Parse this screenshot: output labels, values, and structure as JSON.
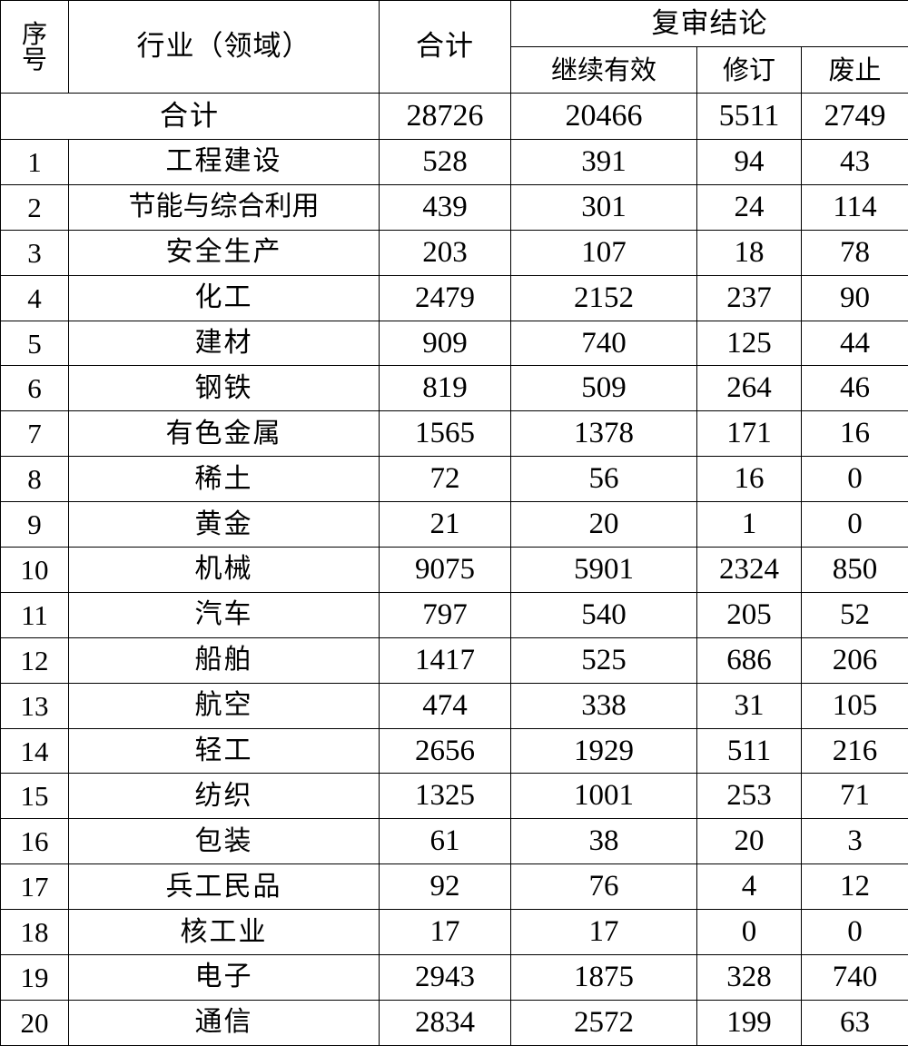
{
  "table": {
    "headers": {
      "index": "序\n号",
      "index_line1": "序",
      "index_line2": "号",
      "name": "行业（领域）",
      "total": "合计",
      "review_group": "复审结论",
      "still_valid": "继续有效",
      "revised": "修订",
      "abolished": "废止"
    },
    "totals_row": {
      "label": "合计",
      "total": "28726",
      "still_valid": "20466",
      "revised": "5511",
      "abolished": "2749"
    },
    "rows": [
      {
        "index": "1",
        "name": "工程建设",
        "total": "528",
        "still_valid": "391",
        "revised": "94",
        "abolished": "43"
      },
      {
        "index": "2",
        "name": "节能与综合利用",
        "total": "439",
        "still_valid": "301",
        "revised": "24",
        "abolished": "114"
      },
      {
        "index": "3",
        "name": "安全生产",
        "total": "203",
        "still_valid": "107",
        "revised": "18",
        "abolished": "78"
      },
      {
        "index": "4",
        "name": "化工",
        "total": "2479",
        "still_valid": "2152",
        "revised": "237",
        "abolished": "90"
      },
      {
        "index": "5",
        "name": "建材",
        "total": "909",
        "still_valid": "740",
        "revised": "125",
        "abolished": "44"
      },
      {
        "index": "6",
        "name": "钢铁",
        "total": "819",
        "still_valid": "509",
        "revised": "264",
        "abolished": "46"
      },
      {
        "index": "7",
        "name": "有色金属",
        "total": "1565",
        "still_valid": "1378",
        "revised": "171",
        "abolished": "16"
      },
      {
        "index": "8",
        "name": "稀土",
        "total": "72",
        "still_valid": "56",
        "revised": "16",
        "abolished": "0"
      },
      {
        "index": "9",
        "name": "黄金",
        "total": "21",
        "still_valid": "20",
        "revised": "1",
        "abolished": "0"
      },
      {
        "index": "10",
        "name": "机械",
        "total": "9075",
        "still_valid": "5901",
        "revised": "2324",
        "abolished": "850"
      },
      {
        "index": "11",
        "name": "汽车",
        "total": "797",
        "still_valid": "540",
        "revised": "205",
        "abolished": "52"
      },
      {
        "index": "12",
        "name": "船舶",
        "total": "1417",
        "still_valid": "525",
        "revised": "686",
        "abolished": "206"
      },
      {
        "index": "13",
        "name": "航空",
        "total": "474",
        "still_valid": "338",
        "revised": "31",
        "abolished": "105"
      },
      {
        "index": "14",
        "name": "轻工",
        "total": "2656",
        "still_valid": "1929",
        "revised": "511",
        "abolished": "216"
      },
      {
        "index": "15",
        "name": "纺织",
        "total": "1325",
        "still_valid": "1001",
        "revised": "253",
        "abolished": "71"
      },
      {
        "index": "16",
        "name": "包装",
        "total": "61",
        "still_valid": "38",
        "revised": "20",
        "abolished": "3"
      },
      {
        "index": "17",
        "name": "兵工民品",
        "total": "92",
        "still_valid": "76",
        "revised": "4",
        "abolished": "12"
      },
      {
        "index": "18",
        "name": "核工业",
        "total": "17",
        "still_valid": "17",
        "revised": "0",
        "abolished": "0"
      },
      {
        "index": "19",
        "name": "电子",
        "total": "2943",
        "still_valid": "1875",
        "revised": "328",
        "abolished": "740"
      },
      {
        "index": "20",
        "name": "通信",
        "total": "2834",
        "still_valid": "2572",
        "revised": "199",
        "abolished": "63"
      }
    ]
  },
  "colors": {
    "border": "#000000",
    "text": "#000000",
    "background": "#ffffff"
  }
}
